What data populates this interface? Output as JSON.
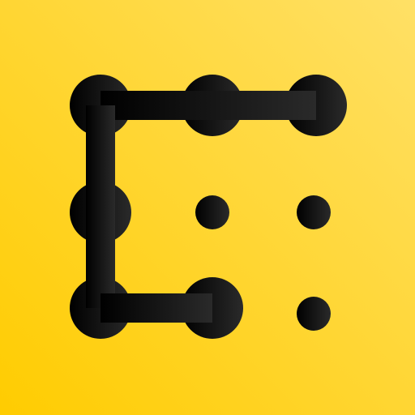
{
  "icon": {
    "name": "yellow-app-icon-with-black-blob-e-mark",
    "background_gradient_start": "#ffcc00",
    "background_gradient_end": "#ffe066",
    "mark_color_start": "#000000",
    "mark_color_end": "#2a2a2a"
  }
}
